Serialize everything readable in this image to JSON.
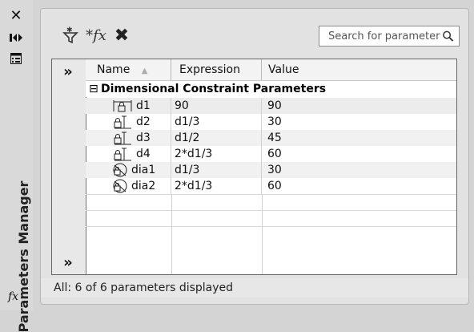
{
  "sidebar": {
    "close_glyph": "✕",
    "autohide_glyph": "⇹",
    "properties_glyph": "▤",
    "title": "Parameters Manager",
    "fx_glyph": "fx"
  },
  "toolbar": {
    "new_user_param_glyph": "⊽",
    "fx_glyph": "*fx",
    "delete_glyph": "✖"
  },
  "search": {
    "placeholder": "Search for parameter"
  },
  "filter": {
    "expand_top": "»",
    "expand_bottom": "»"
  },
  "columns": {
    "name": "Name",
    "sort_indicator": "▲",
    "expression": "Expression",
    "value": "Value"
  },
  "group": {
    "toggle": "⊟",
    "title": "Dimensional Constraint Parameters"
  },
  "rows": [
    {
      "icon": "horizontal-lock-dimension-icon",
      "name": "d1",
      "expression": "90",
      "value": "90"
    },
    {
      "icon": "vertical-lock-dimension-icon",
      "name": "d2",
      "expression": "d1/3",
      "value": "30"
    },
    {
      "icon": "vertical-lock-dimension-icon",
      "name": "d3",
      "expression": "d1/2",
      "value": "45"
    },
    {
      "icon": "vertical-lock-dimension-icon",
      "name": "d4",
      "expression": "2*d1/3",
      "value": "60"
    },
    {
      "icon": "diameter-lock-dimension-icon",
      "name": "dia1",
      "expression": "d1/3",
      "value": "30"
    },
    {
      "icon": "diameter-lock-dimension-icon",
      "name": "dia2",
      "expression": "2*d1/3",
      "value": "60"
    }
  ],
  "status": "All: 6 of 6 parameters displayed",
  "colors": {
    "panel": "#e2e2e2",
    "grid_bg": "#ffffff",
    "sidebar": "#d9d9d9"
  }
}
